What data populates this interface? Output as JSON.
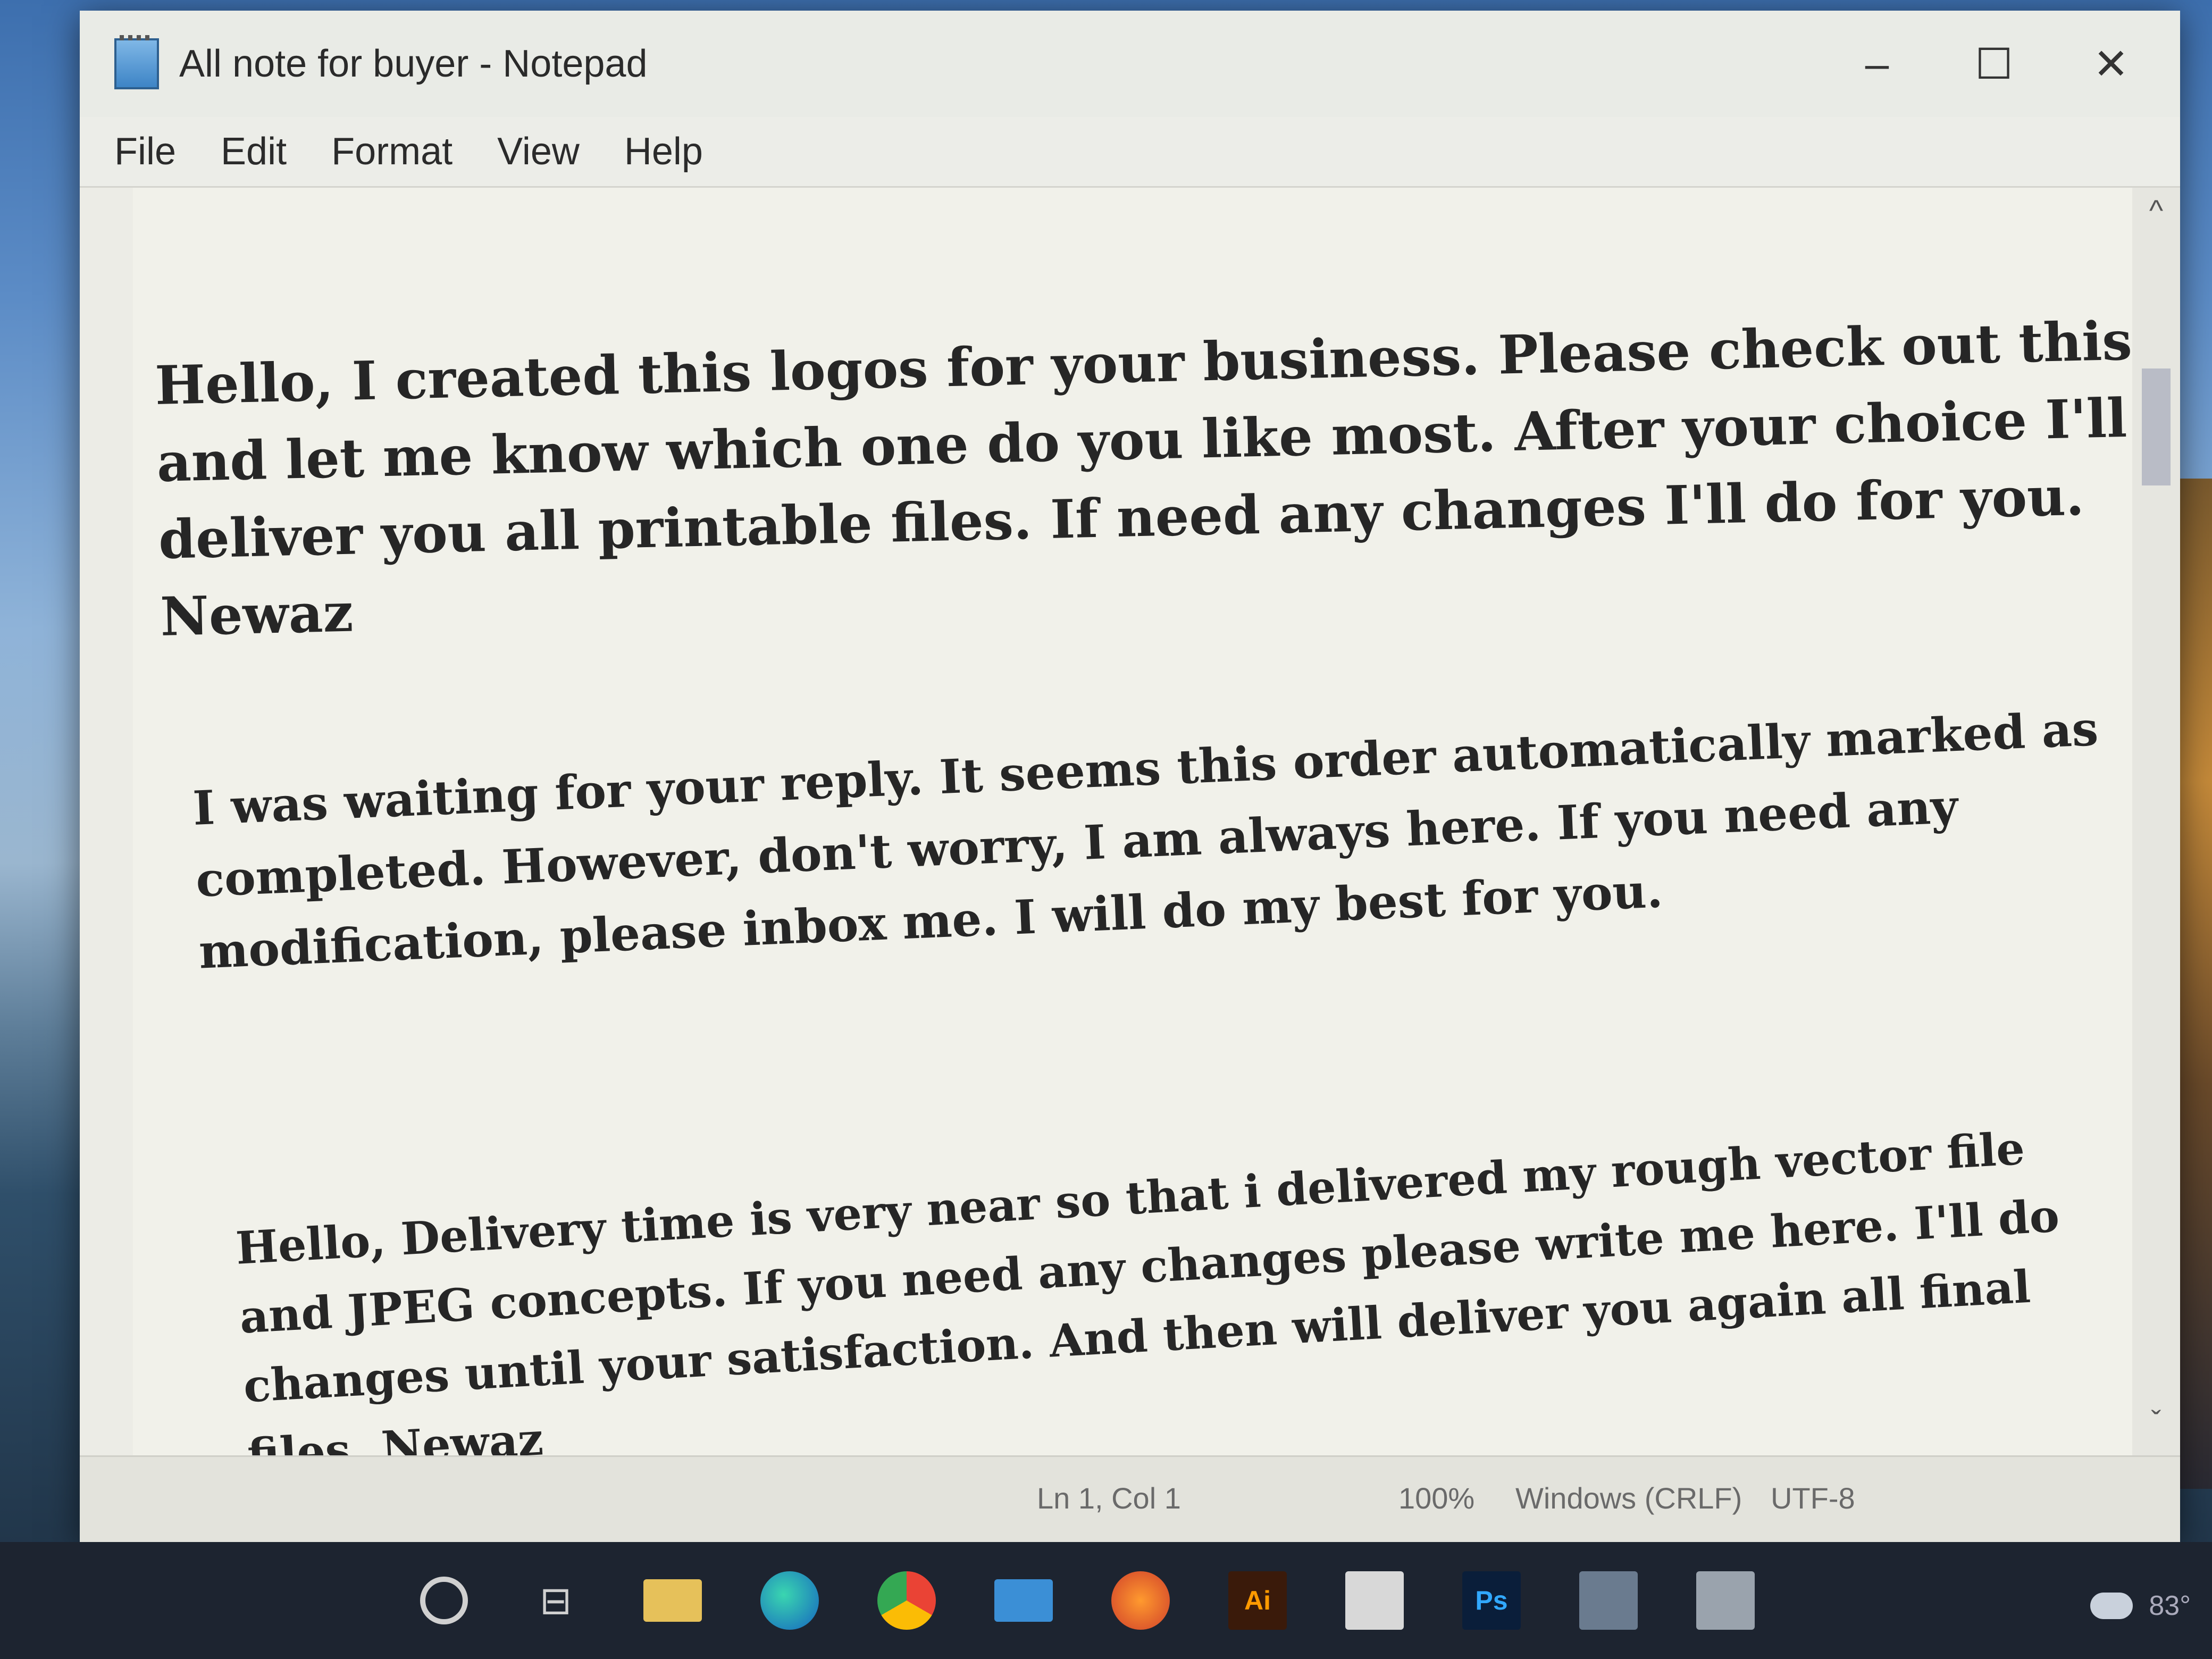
{
  "window": {
    "title": "All note for buyer - Notepad",
    "controls": {
      "minimize": "–",
      "maximize": "☐",
      "close": "✕"
    }
  },
  "menu": {
    "items": [
      "File",
      "Edit",
      "Format",
      "View",
      "Help"
    ]
  },
  "editor": {
    "paragraphs": [
      "Hello, I created this logos for your business. Please check out this and let me know which one do you like most. After your choice I'll deliver you all printable files. If need any changes I'll do for you. Newaz",
      "I was waiting for your reply. It seems this order automatically marked as completed. However, don't worry, I am always here. If you need any modification, please inbox me. I will do my best for you.",
      "Hello, Delivery time is very near so that i delivered my rough vector file and JPEG concepts. If you need any changes please write me here. I'll do changes until your satisfaction. And then will deliver you again all final files. Newaz"
    ]
  },
  "scrollbar": {
    "up_icon": "^",
    "down_icon": "ˇ"
  },
  "statusbar": {
    "position": "Ln 1, Col 1",
    "zoom": "100%",
    "line_ending": "Windows (CRLF)",
    "encoding": "UTF-8"
  },
  "taskbar": {
    "ai_label": "Ai",
    "ps_label": "Ps",
    "taskview_glyph": "⊟",
    "temperature": "83°"
  }
}
